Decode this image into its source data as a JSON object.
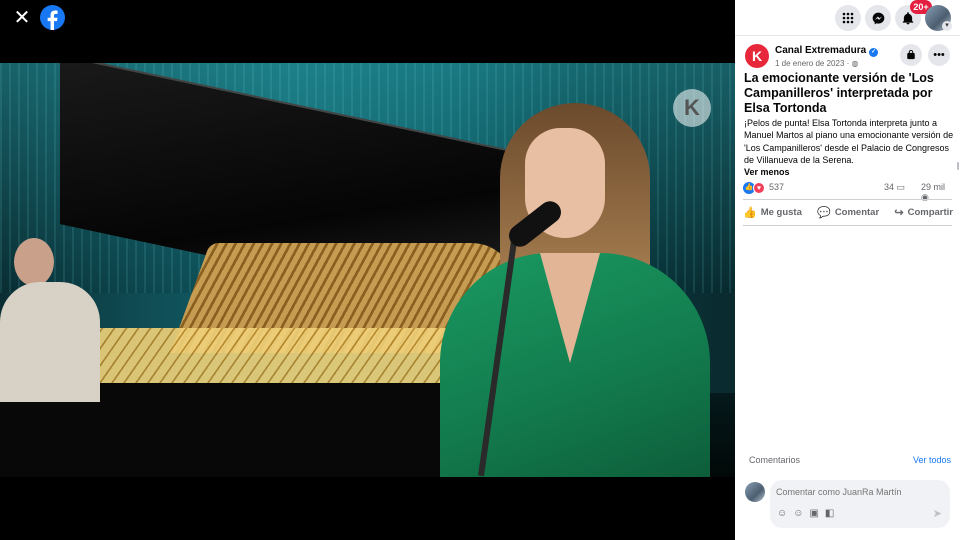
{
  "viewer": {
    "close_glyph": "✕",
    "watermark_glyph": "K"
  },
  "topbar": {
    "notification_badge": "20+"
  },
  "post": {
    "page_name": "Canal Extremadura",
    "page_initial": "K",
    "date": "1 de enero de 2023 · ",
    "title": "La emocionante versión de 'Los Campanilleros' interpretada por Elsa Tortonda",
    "body": "¡Pelos de punta! Elsa Tortonda interpreta junto a Manuel Martos al piano una emocionante versión de 'Los Campanilleros' desde el Palacio de Congresos de Villanueva de la Serena.",
    "see_less": "Ver menos",
    "reactions_count": "537",
    "comments_count": "34",
    "views_count": "29 mil"
  },
  "actions": {
    "like": "Me gusta",
    "comment": "Comentar",
    "share": "Compartir"
  },
  "comments": {
    "header": "Comentarios",
    "see_all": "Ver todos",
    "placeholder": "Comentar como JuanRa Martín"
  },
  "colors": {
    "facebook_blue": "#1877f2",
    "channel_red": "#e7283a",
    "badge_red": "#e41e3f"
  }
}
